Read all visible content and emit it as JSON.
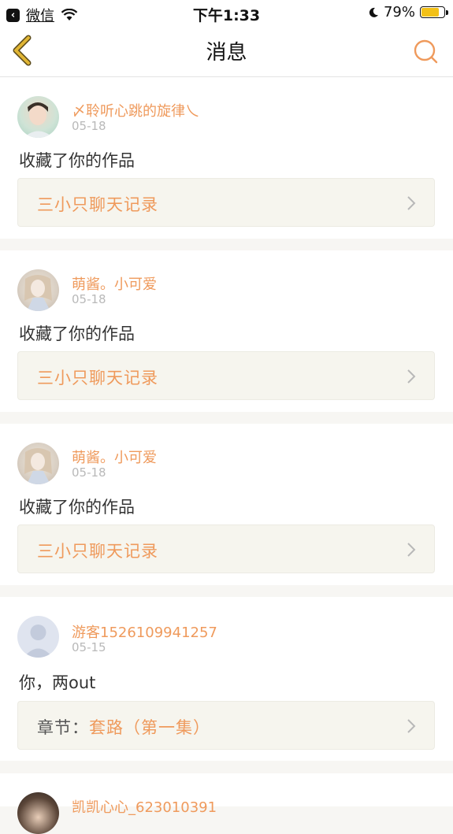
{
  "status_bar": {
    "back_app": "微信",
    "time": "下午1:33",
    "battery": "79%",
    "battery_level": 0.79
  },
  "nav": {
    "title": "消息"
  },
  "messages": [
    {
      "user": "〆聆听心跳的旋律乀",
      "date": "05-18",
      "text": "收藏了你的作品",
      "link_label": "三小只聊天记录",
      "link_prefix": ""
    },
    {
      "user": "萌酱。小可爱",
      "date": "05-18",
      "text": "收藏了你的作品",
      "link_label": "三小只聊天记录",
      "link_prefix": ""
    },
    {
      "user": "萌酱。小可爱",
      "date": "05-18",
      "text": "收藏了你的作品",
      "link_label": "三小只聊天记录",
      "link_prefix": ""
    },
    {
      "user": "游客1526109941257",
      "date": "05-15",
      "text": "你，两out",
      "link_prefix": "章节：",
      "link_label": "套路（第一集）"
    },
    {
      "user": "凯凯心心_623010391",
      "date": "",
      "text": "",
      "link_label": "",
      "link_prefix": ""
    }
  ],
  "colors": {
    "accent": "#ef9a5c",
    "back_chevron": "#e0b534",
    "battery": "#f3c117"
  }
}
